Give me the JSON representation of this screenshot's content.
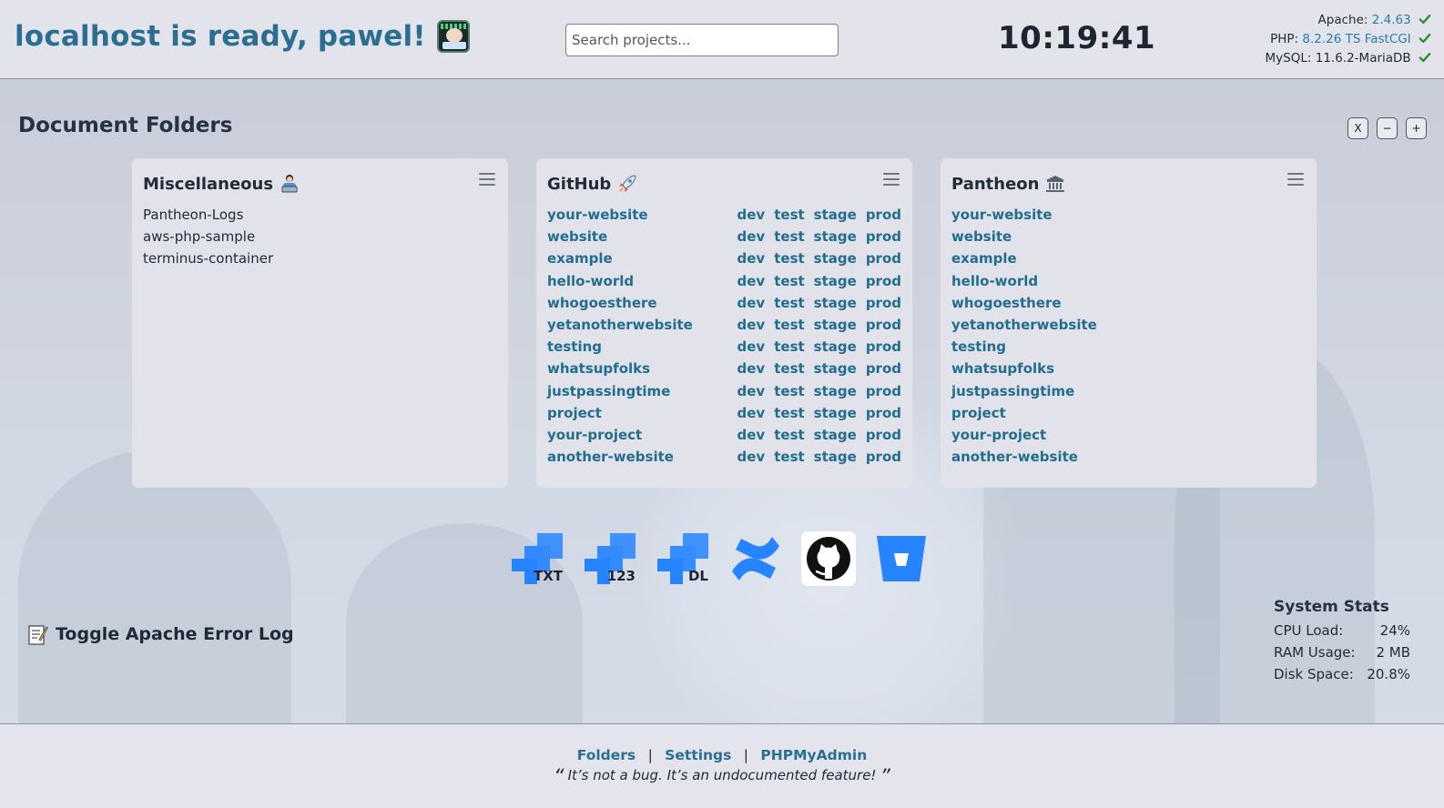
{
  "header": {
    "title": "localhost is ready, pawel!",
    "avatar_icon": "coder-avatar-icon",
    "search_placeholder": "Search projects...",
    "clock": "10:19:41",
    "versions": [
      {
        "label": "Apache:",
        "value": "2.4.63",
        "linked": true
      },
      {
        "label": "PHP:",
        "value": "8.2.26 TS FastCGI",
        "linked": true
      },
      {
        "label": "MySQL:",
        "value": "11.6.2-MariaDB",
        "linked": false
      }
    ],
    "ok_color": "#2e8b2e"
  },
  "section": {
    "title": "Document Folders",
    "controls": [
      "X",
      "−",
      "+"
    ]
  },
  "cards": {
    "misc": {
      "title": "Miscellaneous",
      "icon": "person-at-laptop-icon",
      "items": [
        "Pantheon-Logs",
        "aws-php-sample",
        "terminus-container"
      ]
    },
    "github": {
      "title": "GitHub",
      "icon": "rocket-icon",
      "envs": [
        "dev",
        "test",
        "stage",
        "prod"
      ],
      "items": [
        "your-website",
        "website",
        "example",
        "hello-world",
        "whogoesthere",
        "yetanotherwebsite",
        "testing",
        "whatsupfolks",
        "justpassingtime",
        "project",
        "your-project",
        "another-website"
      ]
    },
    "pantheon": {
      "title": "Pantheon",
      "icon": "classical-building-icon",
      "items": [
        "your-website",
        "website",
        "example",
        "hello-world",
        "whogoesthere",
        "yetanotherwebsite",
        "testing",
        "whatsupfolks",
        "justpassingtime",
        "project",
        "your-project",
        "another-website"
      ]
    }
  },
  "apps": [
    {
      "name": "jira-txt-icon",
      "label": "TXT"
    },
    {
      "name": "jira-123-icon",
      "label": "123"
    },
    {
      "name": "jira-dl-icon",
      "label": "DL"
    },
    {
      "name": "confluence-icon",
      "label": ""
    },
    {
      "name": "github-icon",
      "label": ""
    },
    {
      "name": "bitbucket-icon",
      "label": ""
    }
  ],
  "error_log": {
    "label": "Toggle Apache Error Log",
    "icon": "memo-icon"
  },
  "stats": {
    "title": "System Stats",
    "rows": [
      {
        "label": "CPU Load:",
        "value": "24%"
      },
      {
        "label": "RAM Usage:",
        "value": "2 MB"
      },
      {
        "label": "Disk Space:",
        "value": "20.8%"
      }
    ]
  },
  "footer": {
    "links": [
      "Folders",
      "Settings",
      "PHPMyAdmin"
    ],
    "separator": "|",
    "quote": "It’s not a bug. It’s an undocumented feature!",
    "quote_open": "“",
    "quote_close": "”"
  },
  "colors": {
    "accent": "#2a6f92",
    "link": "#236e8f",
    "brand_blue": "#2684ff"
  }
}
